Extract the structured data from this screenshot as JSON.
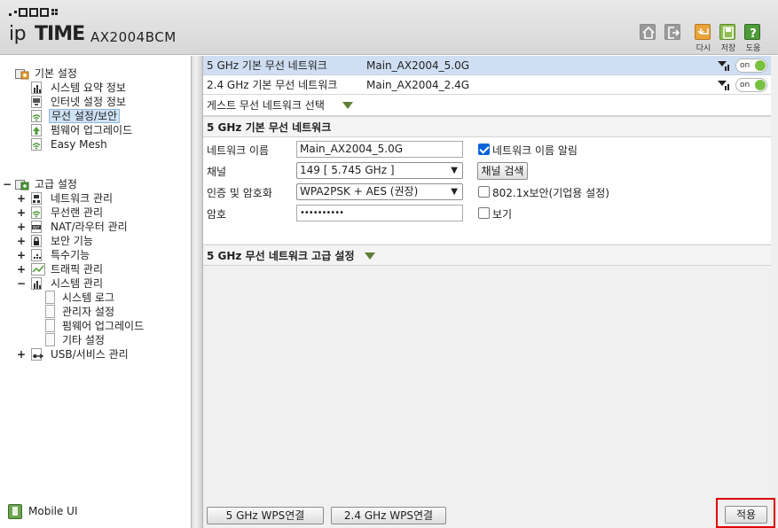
{
  "header": {
    "logo_ip": "ip",
    "logo_time": "TIME",
    "model": "AX2004BCM",
    "buttons": [
      {
        "name": "home",
        "icon": "home-icon",
        "label": ""
      },
      {
        "name": "logout",
        "icon": "logout-icon",
        "label": ""
      },
      {
        "name": "again",
        "icon": "undo-icon",
        "label": "다시"
      },
      {
        "name": "save",
        "icon": "save-icon",
        "label": "저장"
      },
      {
        "name": "help",
        "icon": "help-icon",
        "label": "도움"
      }
    ]
  },
  "sidebar": {
    "basic": {
      "title": "기본 설정",
      "items": [
        {
          "label": "시스템 요약 정보"
        },
        {
          "label": "인터넷 설정 정보"
        },
        {
          "label": "무선 설정/보안",
          "selected": true
        },
        {
          "label": "펌웨어 업그레이드"
        },
        {
          "label": "Easy Mesh"
        }
      ]
    },
    "advanced": {
      "expander": "−",
      "title": "고급 설정",
      "items": [
        {
          "expander": "+",
          "label": "네트워크 관리"
        },
        {
          "expander": "+",
          "label": "무선랜 관리"
        },
        {
          "expander": "+",
          "label": "NAT/라우터 관리"
        },
        {
          "expander": "+",
          "label": "보안 기능"
        },
        {
          "expander": "+",
          "label": "특수기능"
        },
        {
          "expander": "+",
          "label": "트래픽 관리"
        },
        {
          "expander": "−",
          "label": "시스템 관리"
        }
      ],
      "system_children": [
        {
          "label": "시스템 로그"
        },
        {
          "label": "관리자 설정"
        },
        {
          "label": "펌웨어 업그레이드"
        },
        {
          "label": "기타 설정"
        }
      ],
      "usb": {
        "expander": "+",
        "label": "USB/서비스 관리"
      }
    },
    "mobile_ui": "Mobile UI"
  },
  "main": {
    "networks": [
      {
        "band": "5 GHz 기본 무선 네트워크",
        "ssid": "Main_AX2004_5.0G",
        "toggle": "on"
      },
      {
        "band": "2.4 GHz 기본 무선 네트워크",
        "ssid": "Main_AX2004_2.4G",
        "toggle": "on"
      }
    ],
    "guest_select": "게스트 무선 네트워크 선택",
    "basic_section": {
      "title": "5 GHz 기본 무선 네트워크",
      "network_name_label": "네트워크 이름",
      "network_name_value": "Main_AX2004_5.0G",
      "broadcast_label": "네트워크 이름 알림",
      "channel_label": "채널",
      "channel_value": "149 [ 5.745 GHz ]",
      "channel_scan_button": "채널 검색",
      "auth_label": "인증 및 암호화",
      "auth_value": "WPA2PSK + AES (권장)",
      "enterprise_label": "802.1x보안(기업용 설정)",
      "password_label": "암호",
      "password_value": "••••••••••",
      "show_label": "보기"
    },
    "advanced_section": {
      "title": "5 GHz 무선 네트워크 고급 설정"
    },
    "footer": {
      "wps5": "5 GHz WPS연결",
      "wps24": "2.4 GHz WPS연결",
      "apply": "적용"
    }
  },
  "colors": {
    "accent_green": "#79c143",
    "selected_row": "#cfdef2",
    "highlight_red": "#e00000",
    "triangle_green": "#5d7f35"
  }
}
